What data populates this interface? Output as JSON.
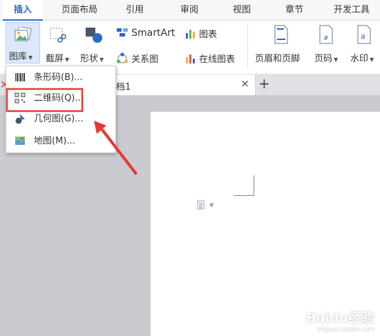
{
  "tabs": [
    "插入",
    "页面布局",
    "引用",
    "审阅",
    "视图",
    "章节",
    "开发工具"
  ],
  "ribbon": {
    "gallery": "图库",
    "screenshot": "截屏",
    "shapes": "形状",
    "smartart": "SmartArt",
    "chart": "图表",
    "relation": "关系图",
    "online_chart": "在线图表",
    "header_footer": "页眉和页脚",
    "page_number": "页码",
    "watermark": "水印"
  },
  "document_tab": {
    "title": "档1",
    "close": "×",
    "new": "+"
  },
  "gallery_menu": {
    "items": [
      {
        "label": "条形码(B)...",
        "icon": "barcode-icon"
      },
      {
        "label": "二维码(Q)...",
        "icon": "qrcode-icon"
      },
      {
        "label": "几何图(G)...",
        "icon": "geometry-icon"
      },
      {
        "label": "地图(M)...",
        "icon": "map-icon"
      }
    ]
  },
  "colors": {
    "accent": "#2a69c9",
    "highlight_box": "#e53935",
    "arrow": "#e53935"
  },
  "watermark": {
    "brand": "Baidu经验",
    "url": "jingyan.baidu.com"
  }
}
